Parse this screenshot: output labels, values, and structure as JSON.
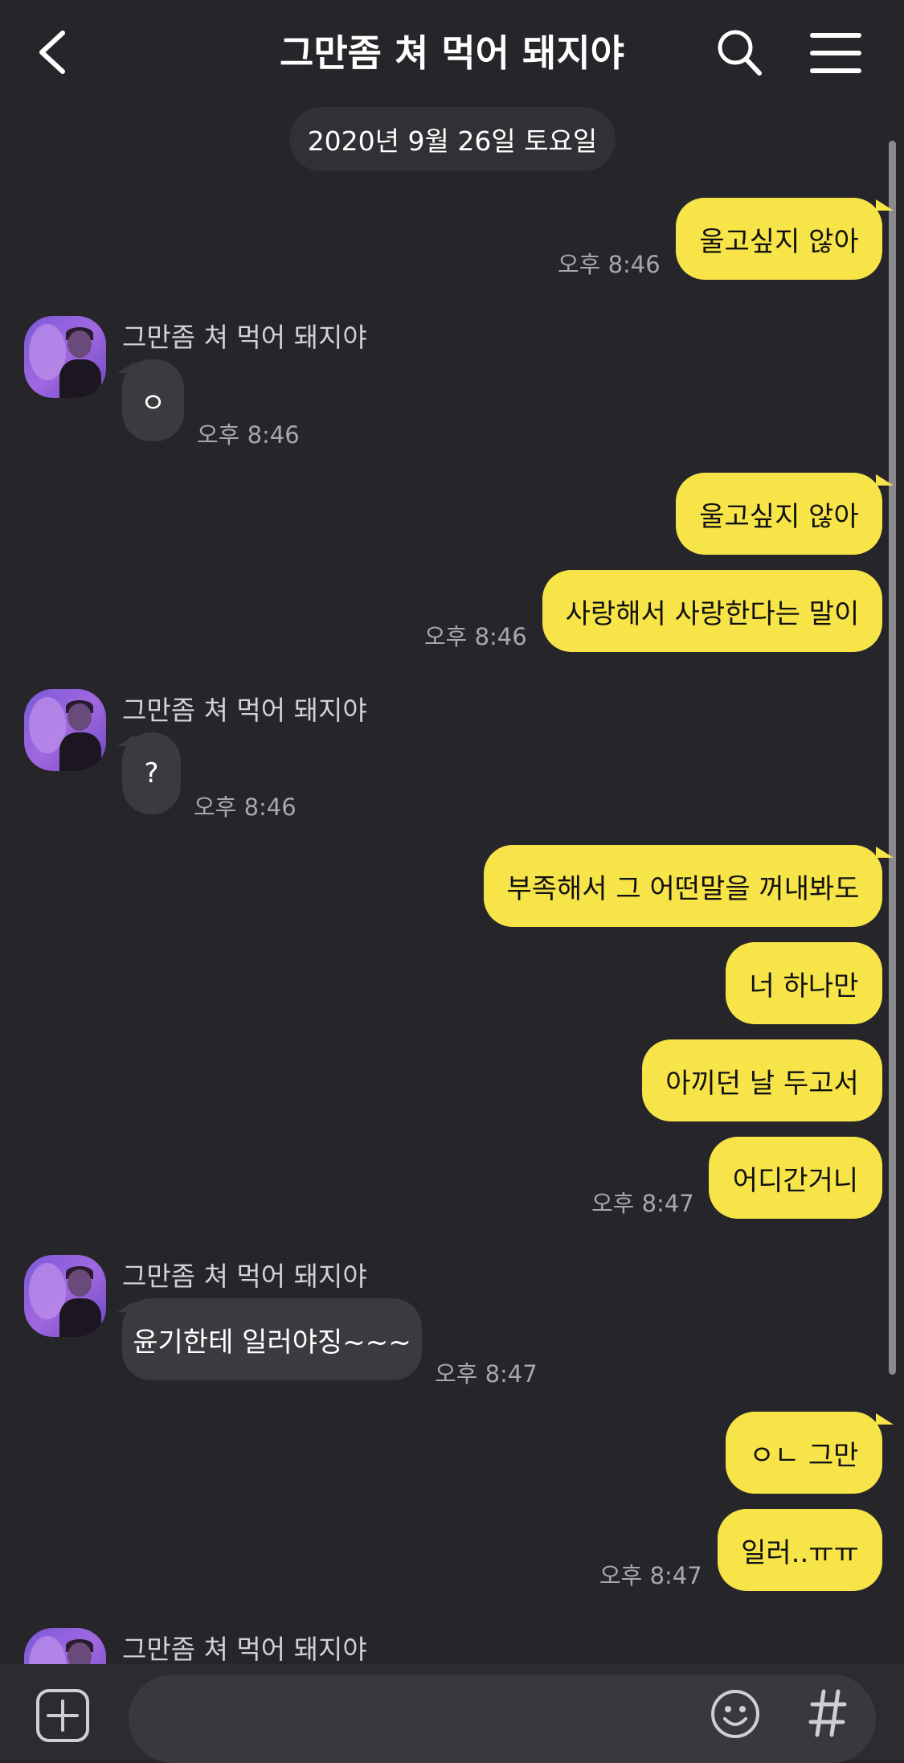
{
  "header": {
    "title": "그만좀 쳐 먹어 돼지야"
  },
  "date_divider": "2020년 9월 26일 토요일",
  "sender_name": "그만좀 쳐 먹어 돼지야",
  "messages": [
    {
      "text": "울고싶지 않아",
      "time": "오후 8:46"
    },
    {
      "text": "ㅇ",
      "time": "오후 8:46"
    },
    {
      "text": "울고싶지 않아"
    },
    {
      "text": "사랑해서 사랑한다는 말이",
      "time": "오후 8:46"
    },
    {
      "text": "?",
      "time": "오후 8:46"
    },
    {
      "text": "부족해서 그 어떤말을 꺼내봐도"
    },
    {
      "text": "너 하나만"
    },
    {
      "text": "아끼던 날 두고서"
    },
    {
      "text": "어디간거니",
      "time": "오후 8:47"
    },
    {
      "text": "윤기한테 일러야징~~~",
      "time": "오후 8:47"
    },
    {
      "text": "ㅇㄴ 그만"
    },
    {
      "text": "일러..ㅠㅠ",
      "time": "오후 8:47"
    }
  ],
  "icons": {
    "back": "chevron-left-icon",
    "search": "search-icon",
    "menu": "menu-icon",
    "attach": "plus-square-icon",
    "emoji": "smiley-icon",
    "hashtag": "hashtag-icon"
  },
  "colors": {
    "background": "#26262a",
    "outgoing_bubble": "#f7e449",
    "incoming_bubble": "#3b3b3f"
  }
}
